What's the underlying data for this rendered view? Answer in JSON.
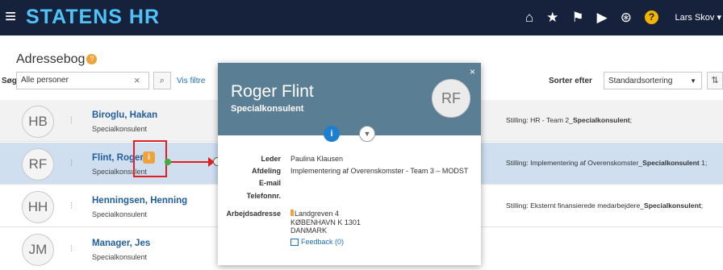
{
  "header": {
    "brand": "STATENS HR",
    "user": "Lars Skov",
    "icons": [
      "home-icon",
      "star-icon",
      "flag-icon",
      "play-icon",
      "accessibility-icon",
      "help-icon"
    ],
    "help_label": "?"
  },
  "page": {
    "title": "Adressebog"
  },
  "search": {
    "label": "Søg",
    "value": "Alle personer",
    "filter_link": "Vis filtre"
  },
  "sort": {
    "label": "Sorter efter",
    "value": "Standardsortering"
  },
  "people": [
    {
      "initials": "HB",
      "name": "Biroglu, Hakan",
      "title": "Specialkonsulent",
      "stilling_prefix": "Stilling: HR - Team 2_",
      "stilling_bold": "Specialkonsulent",
      "stilling_suffix": ";"
    },
    {
      "initials": "RF",
      "name": "Flint, Roger",
      "title": "Specialkonsulent",
      "stilling_prefix": "Stilling: Implementering af Overenskomster_",
      "stilling_bold": "Specialkonsulent",
      "stilling_suffix": " 1;"
    },
    {
      "initials": "HH",
      "name": "Henningsen, Henning",
      "title": "Specialkonsulent",
      "stilling_prefix": "Stilling: Eksternt finansierede medarbejdere_",
      "stilling_bold": "Specialkonsulent",
      "stilling_suffix": ";"
    },
    {
      "initials": "JM",
      "name": "Manager, Jes",
      "title": "Specialkonsulent",
      "stilling_prefix": "",
      "stilling_bold": "",
      "stilling_suffix": ""
    }
  ],
  "popup": {
    "name": "Roger Flint",
    "title": "Specialkonsulent",
    "initials": "RF",
    "close": "×",
    "info_label": "i",
    "labels": {
      "leader": "Leder",
      "department": "Afdeling",
      "email": "E-mail",
      "phone": "Telefonnr.",
      "address": "Arbejdsadresse"
    },
    "values": {
      "leader": "Paulina Klausen",
      "department": "Implementering af Overenskomster - Team 3 – MODST",
      "address_line1": "Landgreven 4",
      "address_line2": "KØBENHAVN K 1301",
      "address_line3": "DANMARK"
    },
    "feedback": "Feedback (0)"
  },
  "annotation": {
    "info_badge": "i"
  }
}
